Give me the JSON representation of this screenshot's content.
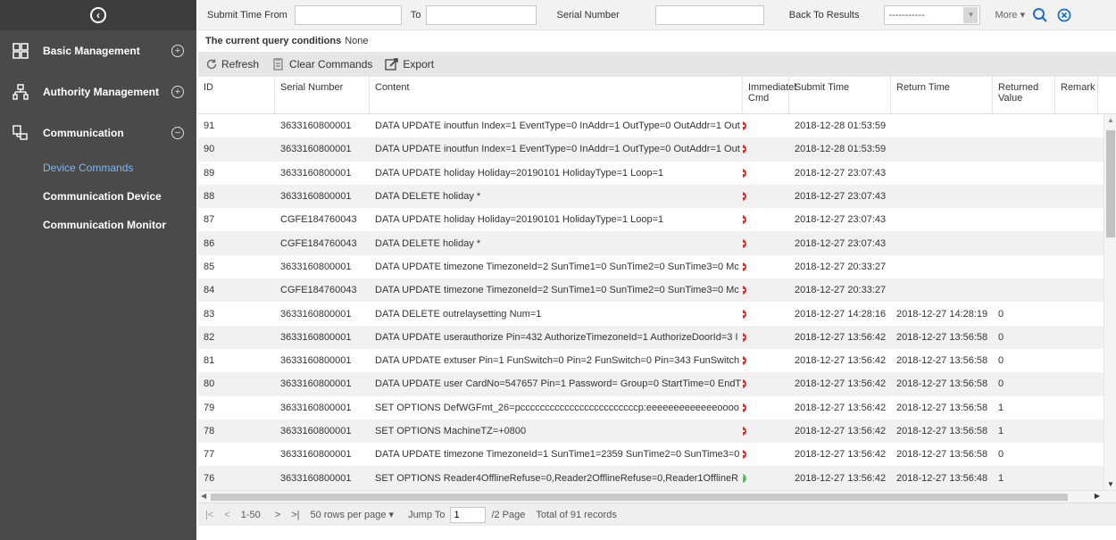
{
  "sidebar": {
    "menus": [
      {
        "label": "Basic Management",
        "toggle": "+"
      },
      {
        "label": "Authority Management",
        "toggle": "+"
      },
      {
        "label": "Communication",
        "toggle": "−"
      }
    ],
    "submenu": [
      {
        "label": "Device Commands",
        "active": true
      },
      {
        "label": "Communication Device",
        "active": false
      },
      {
        "label": "Communication Monitor",
        "active": false
      }
    ]
  },
  "filter": {
    "submit_time_from_label": "Submit Time From",
    "to_label": "To",
    "serial_number_label": "Serial Number",
    "back_to_results_label": "Back To Results",
    "back_to_results_value": "-----------",
    "more_label": "More"
  },
  "query": {
    "label": "The current query conditions",
    "value": "None"
  },
  "toolbar": {
    "refresh": "Refresh",
    "clear": "Clear Commands",
    "export": "Export"
  },
  "table": {
    "headers": {
      "id": "ID",
      "serial": "Serial Number",
      "content": "Content",
      "immediate": "Immediatel Cmd",
      "submit": "Submit Time",
      "return": "Return Time",
      "returned": "Returned Value",
      "remark": "Remark"
    },
    "rows": [
      {
        "id": "91",
        "serial": "3633160800001",
        "content": "DATA UPDATE inoutfun Index=1 EventType=0 InAddr=1 OutType=0 OutAddr=1 Out",
        "status": "red",
        "submit": "2018-12-28 01:53:59",
        "return": "",
        "returned": ""
      },
      {
        "id": "90",
        "serial": "3633160800001",
        "content": "DATA UPDATE inoutfun Index=1 EventType=0 InAddr=1 OutType=0 OutAddr=1 Out",
        "status": "red",
        "submit": "2018-12-28 01:53:59",
        "return": "",
        "returned": ""
      },
      {
        "id": "89",
        "serial": "3633160800001",
        "content": "DATA UPDATE holiday Holiday=20190101 HolidayType=1 Loop=1",
        "status": "red",
        "submit": "2018-12-27 23:07:43",
        "return": "",
        "returned": ""
      },
      {
        "id": "88",
        "serial": "3633160800001",
        "content": "DATA DELETE holiday *",
        "status": "red",
        "submit": "2018-12-27 23:07:43",
        "return": "",
        "returned": ""
      },
      {
        "id": "87",
        "serial": "CGFE184760043",
        "content": "DATA UPDATE holiday Holiday=20190101 HolidayType=1 Loop=1",
        "status": "red",
        "submit": "2018-12-27 23:07:43",
        "return": "",
        "returned": ""
      },
      {
        "id": "86",
        "serial": "CGFE184760043",
        "content": "DATA DELETE holiday *",
        "status": "red",
        "submit": "2018-12-27 23:07:43",
        "return": "",
        "returned": ""
      },
      {
        "id": "85",
        "serial": "3633160800001",
        "content": "DATA UPDATE timezone TimezoneId=2 SunTime1=0 SunTime2=0 SunTime3=0 Mc",
        "status": "red",
        "submit": "2018-12-27 20:33:27",
        "return": "",
        "returned": ""
      },
      {
        "id": "84",
        "serial": "CGFE184760043",
        "content": "DATA UPDATE timezone TimezoneId=2 SunTime1=0 SunTime2=0 SunTime3=0 Mc",
        "status": "red",
        "submit": "2018-12-27 20:33:27",
        "return": "",
        "returned": ""
      },
      {
        "id": "83",
        "serial": "3633160800001",
        "content": "DATA DELETE outrelaysetting Num=1",
        "status": "red",
        "submit": "2018-12-27 14:28:16",
        "return": "2018-12-27 14:28:19",
        "returned": "0"
      },
      {
        "id": "82",
        "serial": "3633160800001",
        "content": "DATA UPDATE userauthorize Pin=432 AuthorizeTimezoneId=1 AuthorizeDoorId=3 I",
        "status": "red",
        "submit": "2018-12-27 13:56:42",
        "return": "2018-12-27 13:56:58",
        "returned": "0"
      },
      {
        "id": "81",
        "serial": "3633160800001",
        "content": "DATA UPDATE extuser Pin=1 FunSwitch=0 Pin=2 FunSwitch=0 Pin=343 FunSwitch",
        "status": "red",
        "submit": "2018-12-27 13:56:42",
        "return": "2018-12-27 13:56:58",
        "returned": "0"
      },
      {
        "id": "80",
        "serial": "3633160800001",
        "content": "DATA UPDATE user CardNo=547657 Pin=1 Password= Group=0 StartTime=0 EndT",
        "status": "red",
        "submit": "2018-12-27 13:56:42",
        "return": "2018-12-27 13:56:58",
        "returned": "0"
      },
      {
        "id": "79",
        "serial": "3633160800001",
        "content": "SET OPTIONS DefWGFmt_26=pccccccccccccccccccccccccp:eeeeeeeeeeeeeoooo",
        "status": "red",
        "submit": "2018-12-27 13:56:42",
        "return": "2018-12-27 13:56:58",
        "returned": "1"
      },
      {
        "id": "78",
        "serial": "3633160800001",
        "content": "SET OPTIONS MachineTZ=+0800",
        "status": "red",
        "submit": "2018-12-27 13:56:42",
        "return": "2018-12-27 13:56:58",
        "returned": "1"
      },
      {
        "id": "77",
        "serial": "3633160800001",
        "content": "DATA UPDATE timezone TimezoneId=1 SunTime1=2359 SunTime2=0 SunTime3=0",
        "status": "red",
        "submit": "2018-12-27 13:56:42",
        "return": "2018-12-27 13:56:58",
        "returned": "0"
      },
      {
        "id": "76",
        "serial": "3633160800001",
        "content": "SET OPTIONS Reader4OfflineRefuse=0,Reader2OfflineRefuse=0,Reader1OfflineR",
        "status": "green",
        "submit": "2018-12-27 13:56:42",
        "return": "2018-12-27 13:56:48",
        "returned": "1"
      }
    ]
  },
  "pager": {
    "first": "|<",
    "prev": "<",
    "range": "1-50",
    "next": ">",
    "last": ">|",
    "rows_per_page": "50 rows per page",
    "jump_to": "Jump To",
    "jump_value": "1",
    "page_total": "/2 Page",
    "total_records": "Total of 91 records"
  },
  "colors": {
    "sidebar_bg": "#4a4a4a",
    "active_item": "#7db9f0",
    "status_red": "#d9342b",
    "status_green": "#5cb85c",
    "accent_blue": "#1e6fd1"
  },
  "icons": {
    "collapse": "chevron-left-circle-icon",
    "basic_mgmt": "grid-icon",
    "authority_mgmt": "org-chart-icon",
    "communication": "network-icon",
    "search": "search-icon",
    "clear_filter": "close-circle-icon"
  }
}
